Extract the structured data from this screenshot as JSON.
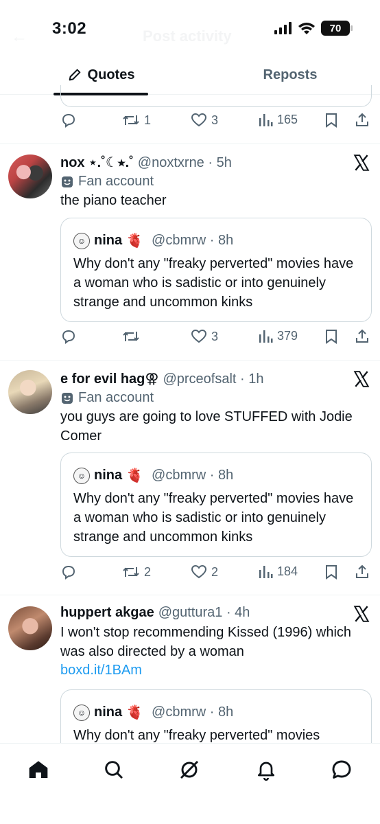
{
  "status_bar": {
    "time": "3:02",
    "battery": "70",
    "ghost_title": "Post activity"
  },
  "tabs": {
    "quotes_label": "Quotes",
    "reposts_label": "Reposts"
  },
  "top_actions": {
    "reposts": "1",
    "likes": "3",
    "views": "165"
  },
  "posts": [
    {
      "display_name": "nox ⋆.˚☾⭒.˚",
      "handle": "@noxtxrne · 5h",
      "fan_label": "Fan account",
      "text": "the piano teacher",
      "quote": {
        "name": "nina",
        "emoji": "🫀",
        "handle": "@cbmrw · 8h",
        "text": "Why don't any \"freaky perverted\" movies have a woman who is sadistic or into genuinely strange and uncommon kinks"
      },
      "actions": {
        "reposts": "",
        "likes": "3",
        "views": "379"
      }
    },
    {
      "display_name": "e for evil hag⚢",
      "handle": "@prceofsalt · 1h",
      "fan_label": "Fan account",
      "text": "you guys are going to love STUFFED with Jodie Comer",
      "quote": {
        "name": "nina",
        "emoji": "🫀",
        "handle": "@cbmrw · 8h",
        "text": "Why don't any \"freaky perverted\" movies have a woman who is sadistic or into genuinely strange and uncommon kinks"
      },
      "actions": {
        "reposts": "2",
        "likes": "2",
        "views": "184"
      }
    },
    {
      "display_name": "huppert akgae",
      "handle": "@guttura1 · 4h",
      "text": "I won't stop recommending Kissed (1996) which was also directed by a woman",
      "link": "boxd.it/1BAm",
      "quote": {
        "name": "nina",
        "emoji": "🫀",
        "handle": "@cbmrw · 8h",
        "text": "Why don't any \"freaky perverted\" movies"
      }
    }
  ],
  "nav": [
    "home-icon",
    "search-icon",
    "grok-icon",
    "notifications-icon",
    "messages-icon"
  ]
}
